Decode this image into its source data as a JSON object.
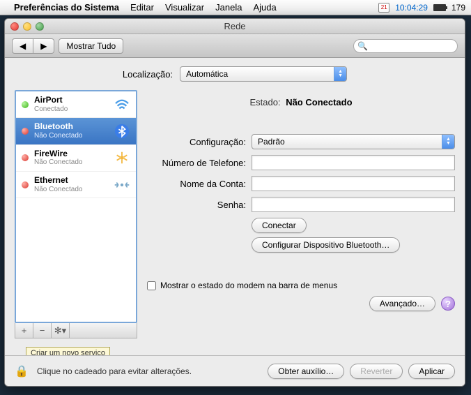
{
  "menubar": {
    "app_name": "Preferências do Sistema",
    "items": [
      "Editar",
      "Visualizar",
      "Janela",
      "Ajuda"
    ],
    "calendar_day": "21",
    "clock": "10:04:29",
    "extra": "179"
  },
  "window": {
    "title": "Rede",
    "show_all": "Mostrar Tudo",
    "search_placeholder": ""
  },
  "location": {
    "label": "Localização:",
    "value": "Automática"
  },
  "services": [
    {
      "name": "AirPort",
      "status": "Conectado",
      "dot": "green",
      "icon": "wifi"
    },
    {
      "name": "Bluetooth",
      "status": "Não Conectado",
      "dot": "red",
      "icon": "bluetooth",
      "selected": true
    },
    {
      "name": "FireWire",
      "status": "Não Conectado",
      "dot": "red",
      "icon": "firewire"
    },
    {
      "name": "Ethernet",
      "status": "Não Conectado",
      "dot": "red",
      "icon": "ethernet"
    }
  ],
  "tooltip": "Criar um novo serviço",
  "detail": {
    "state_label": "Estado:",
    "state_value": "Não Conectado",
    "config_label": "Configuração:",
    "config_value": "Padrão",
    "phone_label": "Número de Telefone:",
    "phone_value": "",
    "account_label": "Nome da Conta:",
    "account_value": "",
    "password_label": "Senha:",
    "password_value": "",
    "connect_btn": "Conectar",
    "configure_bt_btn": "Configurar Dispositivo Bluetooth…",
    "show_modem_label": "Mostrar o estado do modem na barra de menus",
    "advanced_btn": "Avançado…"
  },
  "footer": {
    "lock_text": "Clique no cadeado para evitar alterações.",
    "help_btn": "Obter auxílio…",
    "revert_btn": "Reverter",
    "apply_btn": "Aplicar"
  }
}
